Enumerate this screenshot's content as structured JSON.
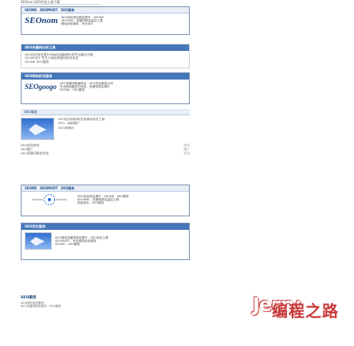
{
  "topbar": {
    "text": "SEOlom SEO优化工具下载"
  },
  "banner1": {
    "tabs": [
      "SEONE",
      "SEOMUDT",
      "SEO服务"
    ],
    "title": "SEOnom",
    "lines": [
      "SEO优化排名稳定提升 - SEONE",
      "SEOUNE - 关键词排名监控工具",
      "网站优化服务 - 专业SEO"
    ]
  },
  "box1": {
    "header": "SEO关键词分析工具",
    "lines": [
      "SEO优化排名提升与网站流量增长的专业解决方案",
      "SEOMUDT 专注于网站关键词排名优化",
      "SEONE SEO服务"
    ]
  },
  "banner2": {
    "header": "SEO网站优化服务",
    "title": "SEOgoogo",
    "lines": [
      "SEO关键词快速排名 - SEO优化服务公司",
      "专业网站建设与优化 - 关键词排名提升",
      "SEONE - SEO服务"
    ]
  },
  "article1": {
    "header": "SEO服务",
    "lines": [
      "SEO优化网站排名关键词排名工具",
      "SEO - 网站推广",
      "SEO关键词"
    ],
    "rows": [
      {
        "left": "SEO优化排名",
        "right": "排名"
      },
      {
        "left": "SEO推广",
        "right": "推广"
      },
      {
        "left": "SEO关键词排名优化",
        "right": "优化"
      }
    ]
  },
  "banner3": {
    "tabs": [
      "SEONE",
      "SEOMUDT",
      "SEO服务"
    ],
    "lines": [
      "SEO优化排名提升 - SEONE - SEO服务",
      "SEOUNE - 关键词排名监控工具",
      "网站优化 - SEO服务"
    ]
  },
  "box2": {
    "header": "SEO优化服务",
    "lines": [
      "SEO网站关键词排名提升 - SEO优化工具",
      "SEOMUDT - 专业网站优化服务",
      "SEONE - SEO服务"
    ]
  },
  "bottom": {
    "title": "SEO服务",
    "lines": [
      "SEO网站优化服务",
      "SEO关键词排名提升 - SEO服务"
    ]
  },
  "watermark": {
    "brand": "Jerry",
    "cn": "编程之路",
    "sub": ""
  },
  "colors": {
    "accent": "#4476b8",
    "title_blue": "#183f7b"
  }
}
